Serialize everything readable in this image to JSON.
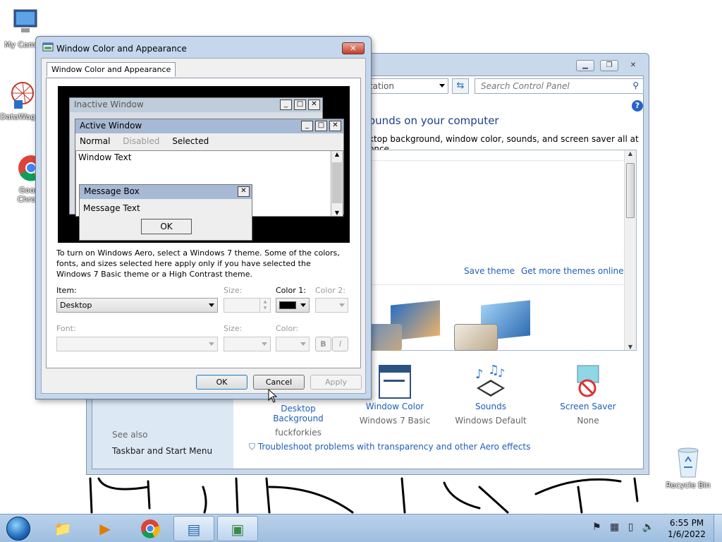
{
  "desktop": {
    "icons": [
      {
        "label": "My Comp",
        "icon": "computer-icon"
      },
      {
        "label": "DataWag",
        "icon": "datawag-icon"
      },
      {
        "label": "Googl Chrom",
        "icon": "chrome-icon"
      },
      {
        "label": "Recycle Bin",
        "icon": "recycle-bin-icon"
      }
    ]
  },
  "control_panel": {
    "address_text": "ization",
    "search_placeholder": "Search Control Panel",
    "heading": "ounds on your computer",
    "subheading": "ktop background, window color, sounds, and screen saver all at once.",
    "save_theme": "Save theme",
    "get_more_themes": "Get more themes online",
    "items": [
      {
        "title": "Desktop Background",
        "value": "fuckforkies",
        "icon": "desktop-background-icon"
      },
      {
        "title": "Window Color",
        "value": "Windows 7 Basic",
        "icon": "window-color-icon"
      },
      {
        "title": "Sounds",
        "value": "Windows Default",
        "icon": "sounds-icon"
      },
      {
        "title": "Screen Saver",
        "value": "None",
        "icon": "screen-saver-icon"
      }
    ],
    "see_also": "See also",
    "taskbar_link": "Taskbar and Start Menu",
    "troubleshoot": "Troubleshoot problems with transparency and other Aero effects"
  },
  "dialog": {
    "title": "Window Color and Appearance",
    "tab": "Window Color and Appearance",
    "preview": {
      "inactive": "Inactive Window",
      "active": "Active Window",
      "menu": [
        "Normal",
        "Disabled",
        "Selected"
      ],
      "window_text": "Window Text",
      "message_box": "Message Box",
      "message_text": "Message Text",
      "ok": "OK"
    },
    "info": "To turn on Windows Aero, select a Windows 7 theme.  Some of the colors, fonts, and sizes selected here apply only if you have selected the Windows 7 Basic theme or a High Contrast theme.",
    "item_label": "Item:",
    "item_value": "Desktop",
    "size_label": "Size:",
    "color1_label": "Color 1:",
    "color2_label": "Color 2:",
    "font_label": "Font:",
    "font_size_label": "Size:",
    "font_color_label": "Color:",
    "bold": "B",
    "italic": "I",
    "ok": "OK",
    "cancel": "Cancel",
    "apply": "Apply",
    "color1": "#000000"
  },
  "taskbar": {
    "time": "6:55 PM",
    "date": "1/6/2022",
    "buttons": [
      "start-orb-icon",
      "explorer-icon",
      "media-player-icon",
      "chrome-icon",
      "control-panel-icon",
      "window-color-icon"
    ]
  }
}
